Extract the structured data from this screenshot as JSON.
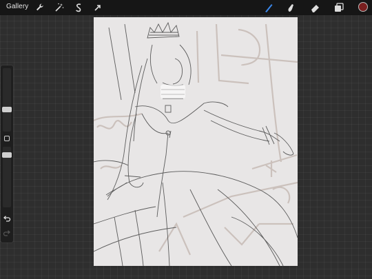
{
  "app": {
    "gallery_label": "Gallery"
  },
  "toolbar_left": [
    {
      "name": "actions-wrench-icon",
      "icon": "wrench"
    },
    {
      "name": "adjustments-wand-icon",
      "icon": "magic-wand"
    },
    {
      "name": "selection-s-icon",
      "icon": "selection-s"
    },
    {
      "name": "transform-arrow-icon",
      "icon": "arrow-cursor"
    }
  ],
  "toolbar_right": [
    {
      "name": "brush-icon",
      "icon": "brush",
      "active": true
    },
    {
      "name": "smudge-icon",
      "icon": "smudge"
    },
    {
      "name": "eraser-icon",
      "icon": "eraser"
    },
    {
      "name": "layers-icon",
      "icon": "layers"
    }
  ],
  "colors": {
    "active_tool": "#3a86e8",
    "current_color": "#7a1f1f",
    "canvas_bg": "#e8e6e6",
    "sketch_line": "#5a5a5a",
    "guide_line": "#c8bdb8"
  },
  "sidebar": {
    "brush_size_level": 0.4,
    "opacity_level": 0.3
  }
}
